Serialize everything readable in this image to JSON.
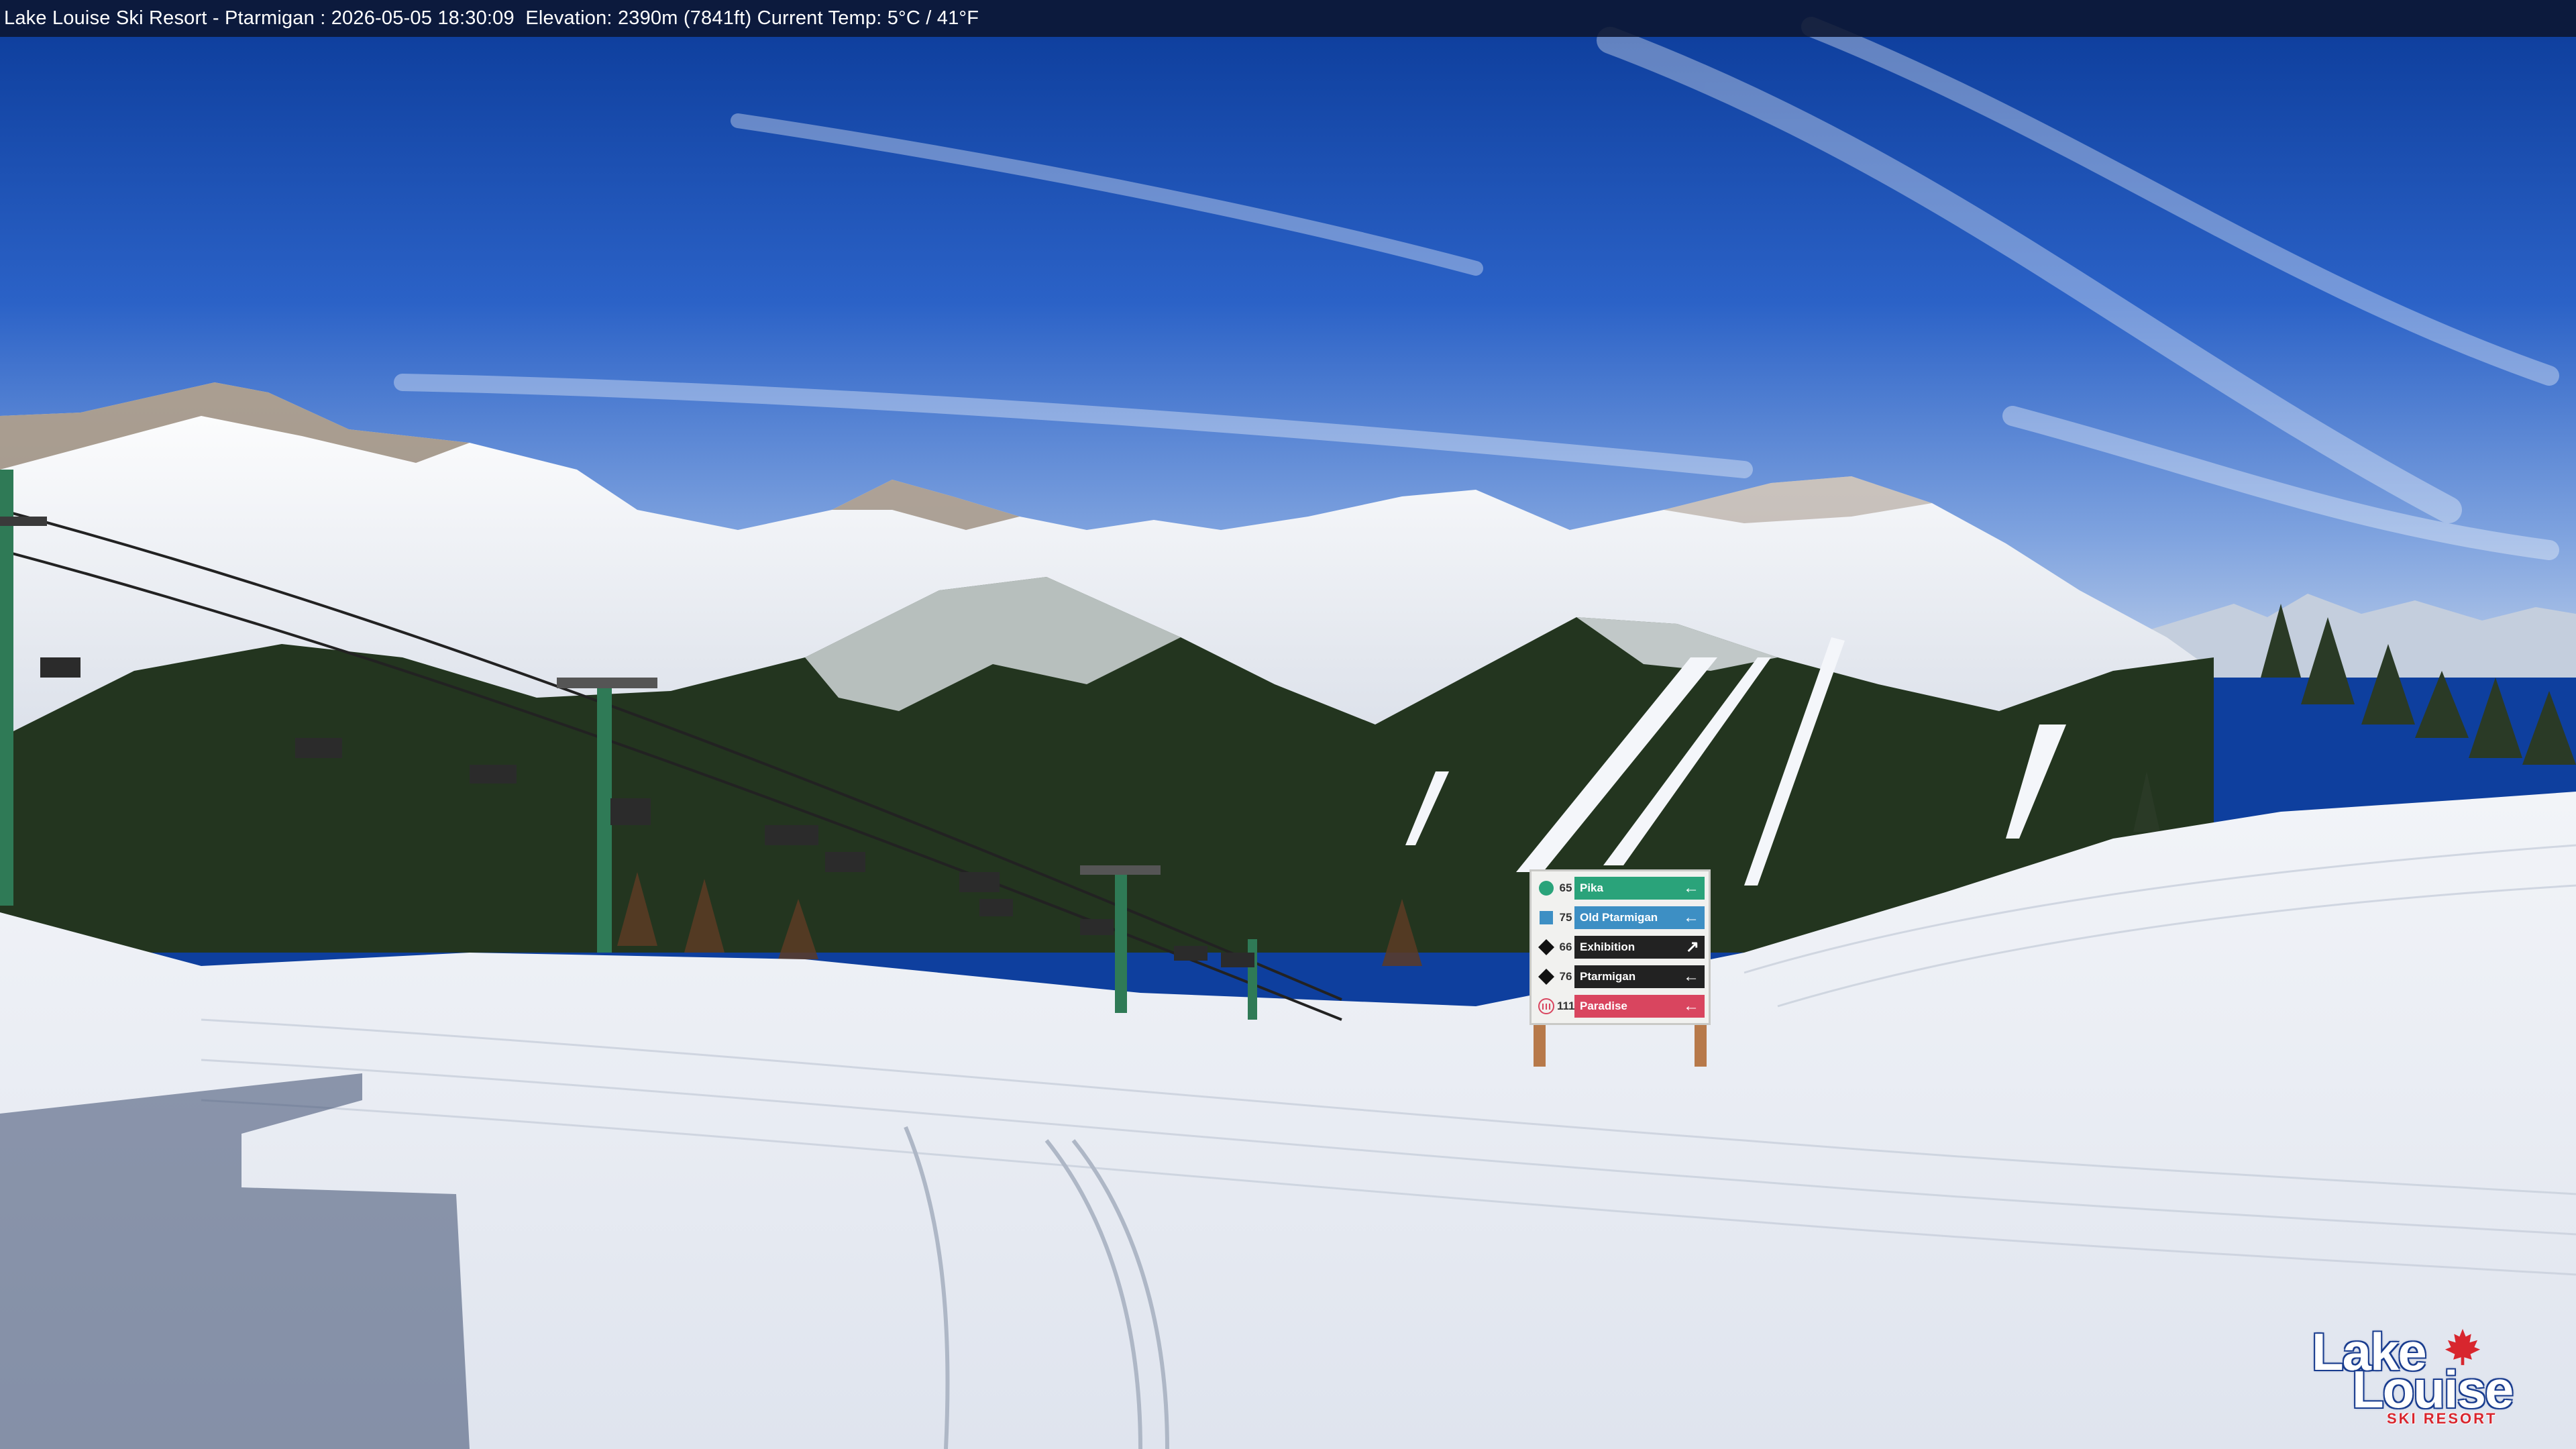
{
  "overlay": {
    "caption": "Lake Louise Ski Resort - Ptarmigan : 2026-05-05 18:30:09  Elevation: 2390m (7841ft) Current Temp: 5°C / 41°F"
  },
  "trail_sign": {
    "rows": [
      {
        "number": "65",
        "name": "Pika",
        "arrow": "←",
        "symbol": "green-circle",
        "color": "#2aa37a"
      },
      {
        "number": "75",
        "name": "Old Ptarmigan",
        "arrow": "←",
        "symbol": "blue-square",
        "color": "#3d8fc4"
      },
      {
        "number": "66",
        "name": "Exhibition",
        "arrow": "↗",
        "symbol": "black-diamond",
        "color": "#222222"
      },
      {
        "number": "76",
        "name": "Ptarmigan",
        "arrow": "←",
        "symbol": "black-diamond",
        "color": "#222222"
      },
      {
        "number": "111",
        "name": "Paradise",
        "arrow": "←",
        "symbol": "lift-icon",
        "color": "#d9455f"
      }
    ]
  },
  "logo": {
    "line1": "Lake",
    "line2": "Louise",
    "sub": "SKI RESORT",
    "leaf_color": "#d8262e"
  }
}
